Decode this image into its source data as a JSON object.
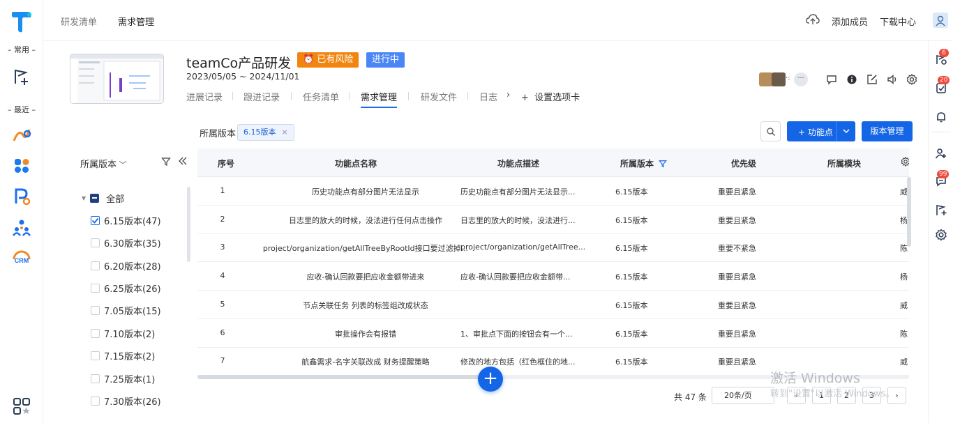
{
  "rail": {
    "section_common": "– 常用 –",
    "section_recent": "– 最近 –",
    "crm_label": "CRM"
  },
  "topbar": {
    "nav": [
      "研发清单",
      "需求管理"
    ],
    "add_member": "添加成员",
    "download": "下载中心"
  },
  "project": {
    "title": "teamCo产品研发",
    "risk_tag": "已有风险",
    "status_tag": "进行中",
    "date_range": "2023/05/05 ~ 2024/11/01",
    "tabs": [
      "进展记录",
      "跟进记录",
      "任务清单",
      "需求管理",
      "研发文件",
      "日志"
    ],
    "settings_tab": "设置选项卡",
    "avatars_more": "···"
  },
  "filter": {
    "label": "所属版本",
    "chip": "6.15版本",
    "add_button": "+ 功能点",
    "version_button": "版本管理"
  },
  "tree": {
    "header": "所属版本",
    "items": [
      {
        "label": "全部",
        "state": "partial"
      },
      {
        "label": "6.15版本(47)",
        "state": "checked"
      },
      {
        "label": "6.30版本(35)",
        "state": "unchecked"
      },
      {
        "label": "6.20版本(28)",
        "state": "unchecked"
      },
      {
        "label": "6.25版本(26)",
        "state": "unchecked"
      },
      {
        "label": "7.05版本(15)",
        "state": "unchecked"
      },
      {
        "label": "7.10版本(2)",
        "state": "unchecked"
      },
      {
        "label": "7.15版本(2)",
        "state": "unchecked"
      },
      {
        "label": "7.25版本(1)",
        "state": "unchecked"
      },
      {
        "label": "7.30版本(26)",
        "state": "unchecked"
      }
    ]
  },
  "table": {
    "columns": [
      "序号",
      "功能点名称",
      "功能点描述",
      "所属版本",
      "优先级",
      "所属模块"
    ],
    "rows": [
      [
        "1",
        "历史功能点有部分图片无法显示",
        "历史功能点有部分图片无法显示...",
        "6.15版本",
        "重要且紧急",
        "威"
      ],
      [
        "2",
        "日志里的放大的时候，没法进行任何点击操作",
        "日志里的放大的时候，没法进行...",
        "6.15版本",
        "重要且紧急",
        "杨"
      ],
      [
        "3",
        "project/organization/getAllTreeByRootId接口要过滤掉...",
        "project/organization/getAllTree...",
        "6.15版本",
        "重要不紧急",
        "陈"
      ],
      [
        "4",
        "应收-确认回款要把应收金额带进来",
        "应收-确认回款要把应收金额带...",
        "6.15版本",
        "重要且紧急",
        "杨"
      ],
      [
        "5",
        "节点关联任务 列表的标签组改成状态",
        "",
        "6.15版本",
        "重要且紧急",
        "威"
      ],
      [
        "6",
        "审批操作会有报错",
        "1、审批点下面的按钮会有一个...",
        "6.15版本",
        "重要且紧急",
        "陈"
      ],
      [
        "7",
        "航鑫需求-名字关联改成 财务提醒策略",
        "修改的地方包括（红色框住的地...",
        "6.15版本",
        "重要且紧急",
        "威"
      ]
    ]
  },
  "pagination": {
    "total": "共 47 条",
    "page_size": "20条/页",
    "pages": [
      "1",
      "2",
      "3"
    ]
  },
  "watermark": {
    "line1": "激活 Windows",
    "line2": "转到\"设置\"以激活 Windows。"
  },
  "right_rail": {
    "badges": [
      "6",
      "20",
      "99"
    ]
  },
  "colors": {
    "primary": "#1466e6",
    "risk": "#f2850f",
    "status": "#4a86f5",
    "badge": "#f04a3a"
  }
}
